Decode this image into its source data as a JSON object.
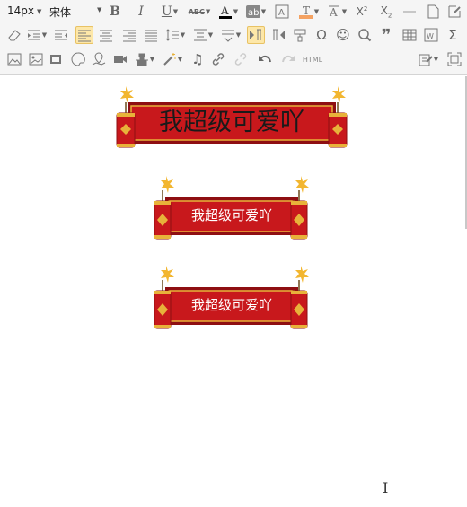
{
  "toolbar": {
    "font_size": "14px",
    "font_family": "宋体",
    "html_label": "HTML"
  },
  "content": {
    "banners": [
      {
        "text": "我超级可爱吖"
      },
      {
        "text": "我超级可爱吖"
      },
      {
        "text": "我超级可爱吖"
      }
    ]
  },
  "colors": {
    "banner_red": "#c8181c",
    "banner_dark_red": "#8e0f12",
    "banner_gold": "#e8b23a",
    "active_highlight": "#fde7a8"
  }
}
